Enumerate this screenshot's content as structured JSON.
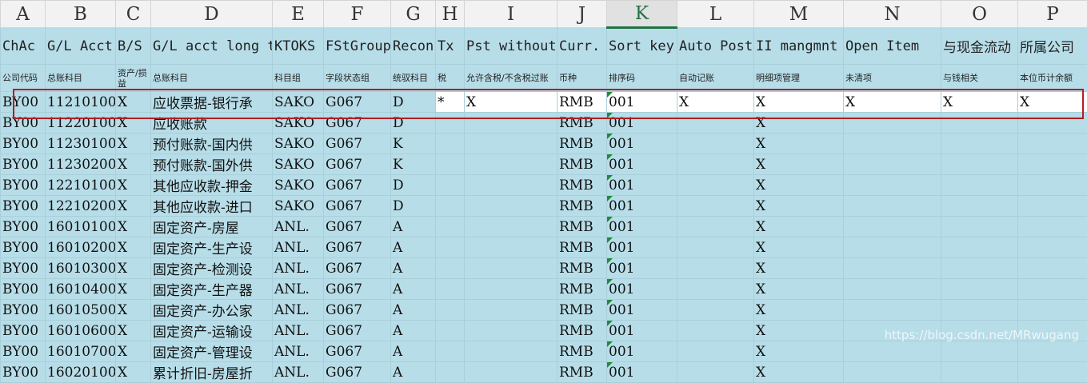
{
  "columns": [
    "A",
    "B",
    "C",
    "D",
    "E",
    "F",
    "G",
    "H",
    "I",
    "J",
    "K",
    "L",
    "M",
    "N",
    "O",
    "P"
  ],
  "header_row1": [
    "ChAc",
    "G/L Acct",
    "B/S",
    "G/L acct long t",
    "KTOKS",
    "FStGroup",
    "Recon",
    "Tx",
    "Pst without",
    "Curr.",
    "Sort key",
    "Auto Post",
    "II mangmnt",
    "Open Item",
    "与现金流动",
    "所属公司"
  ],
  "header_row2": [
    "公司代码",
    "总账科目",
    "资产/损益",
    "总账科目",
    "科目组",
    "字段状态组",
    "统驭科目",
    "税",
    "允许含税/不含税过账",
    "币种",
    "排序码",
    "自动记账",
    "明细项管理",
    "未清项",
    "与钱相关",
    "本位币计余额"
  ],
  "rows": [
    [
      "BY00",
      "11210100",
      "X",
      "应收票据-银行承",
      "SAKO",
      "G067",
      "D",
      "*",
      "X",
      "RMB",
      "001",
      "X",
      "X",
      "X",
      "X",
      "X"
    ],
    [
      "BY00",
      "11220100",
      "X",
      "应收账款",
      "SAKO",
      "G067",
      "D",
      "",
      "",
      "RMB",
      "001",
      "",
      "X",
      "",
      "",
      ""
    ],
    [
      "BY00",
      "11230100",
      "X",
      "预付账款-国内供",
      "SAKO",
      "G067",
      "K",
      "",
      "",
      "RMB",
      "001",
      "",
      "X",
      "",
      "",
      ""
    ],
    [
      "BY00",
      "11230200",
      "X",
      "预付账款-国外供",
      "SAKO",
      "G067",
      "K",
      "",
      "",
      "RMB",
      "001",
      "",
      "X",
      "",
      "",
      ""
    ],
    [
      "BY00",
      "12210100",
      "X",
      "其他应收款-押金",
      "SAKO",
      "G067",
      "D",
      "",
      "",
      "RMB",
      "001",
      "",
      "X",
      "",
      "",
      ""
    ],
    [
      "BY00",
      "12210200",
      "X",
      "其他应收款-进口",
      "SAKO",
      "G067",
      "D",
      "",
      "",
      "RMB",
      "001",
      "",
      "X",
      "",
      "",
      ""
    ],
    [
      "BY00",
      "16010100",
      "X",
      "固定资产-房屋",
      "ANL.",
      "G067",
      "A",
      "",
      "",
      "RMB",
      "001",
      "",
      "X",
      "",
      "",
      ""
    ],
    [
      "BY00",
      "16010200",
      "X",
      "固定资产-生产设",
      "ANL.",
      "G067",
      "A",
      "",
      "",
      "RMB",
      "001",
      "",
      "X",
      "",
      "",
      ""
    ],
    [
      "BY00",
      "16010300",
      "X",
      "固定资产-检测设",
      "ANL.",
      "G067",
      "A",
      "",
      "",
      "RMB",
      "001",
      "",
      "X",
      "",
      "",
      ""
    ],
    [
      "BY00",
      "16010400",
      "X",
      "固定资产-生产器",
      "ANL.",
      "G067",
      "A",
      "",
      "",
      "RMB",
      "001",
      "",
      "X",
      "",
      "",
      ""
    ],
    [
      "BY00",
      "16010500",
      "X",
      "固定资产-办公家",
      "ANL.",
      "G067",
      "A",
      "",
      "",
      "RMB",
      "001",
      "",
      "X",
      "",
      "",
      ""
    ],
    [
      "BY00",
      "16010600",
      "X",
      "固定资产-运输设",
      "ANL.",
      "G067",
      "A",
      "",
      "",
      "RMB",
      "001",
      "",
      "X",
      "",
      "",
      ""
    ],
    [
      "BY00",
      "16010700",
      "X",
      "固定资产-管理设",
      "ANL.",
      "G067",
      "A",
      "",
      "",
      "RMB",
      "001",
      "",
      "X",
      "",
      "",
      ""
    ],
    [
      "BY00",
      "16020100",
      "X",
      "累计折旧-房屋折",
      "ANL.",
      "G067",
      "A",
      "",
      "",
      "RMB",
      "001",
      "",
      "X",
      "",
      "",
      ""
    ]
  ],
  "selected_column": "K",
  "highlighted_row_index": 0,
  "watermark": "https://blog.csdn.net/MRwugang",
  "colors": {
    "header_fill": "#b7dde8",
    "highlight_border": "#b01e23",
    "sort_marker": "#1e8a3a"
  }
}
